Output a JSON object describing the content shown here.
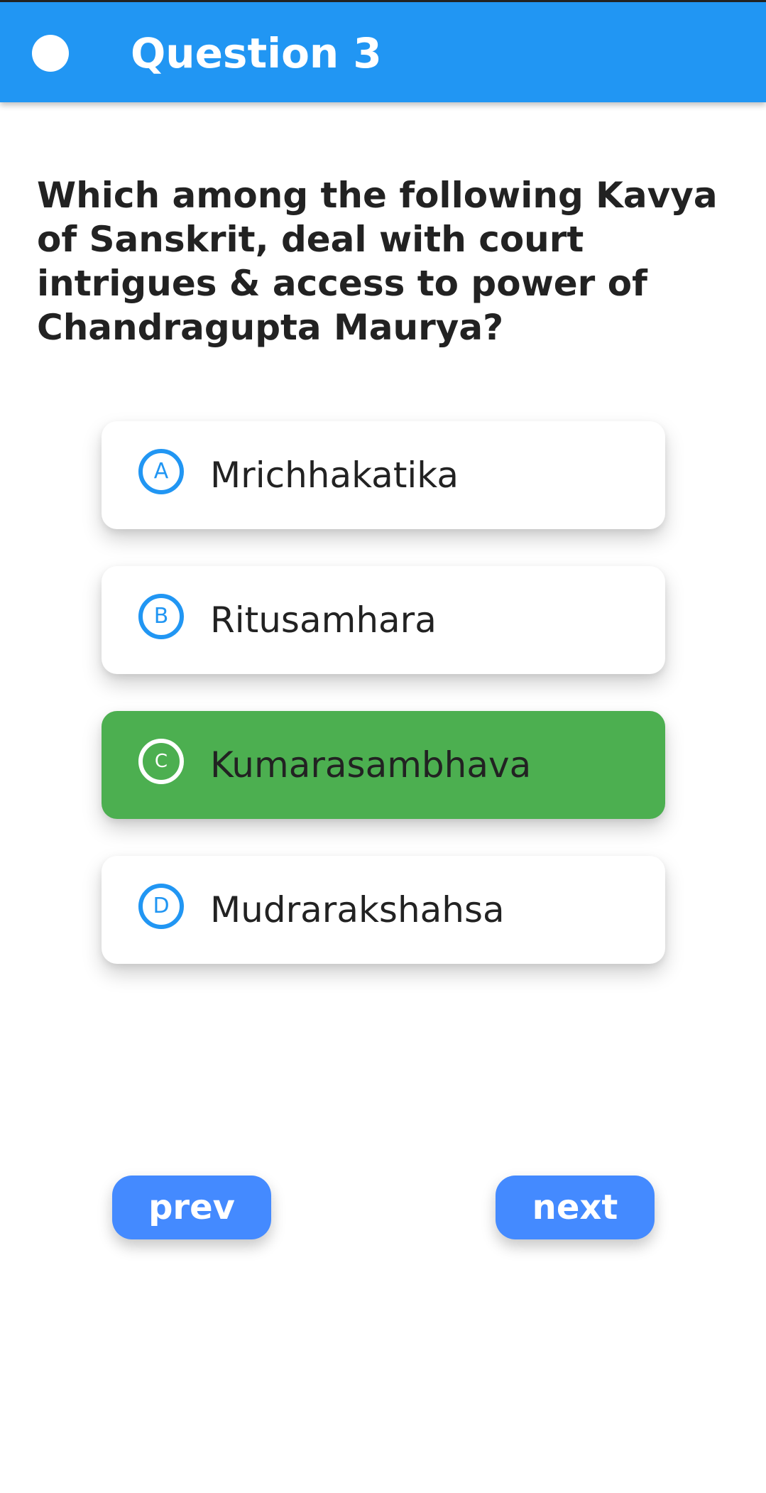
{
  "appbar": {
    "title": "Question 3"
  },
  "question": {
    "text": "Which among the following Kavya of Sanskrit, deal with court intrigues & access to power of Chandragupta Maurya?"
  },
  "options": [
    {
      "letter": "A",
      "label": "Mrichhakatika",
      "selected": false
    },
    {
      "letter": "B",
      "label": "Ritusamhara",
      "selected": false
    },
    {
      "letter": "C",
      "label": "Kumarasambhava",
      "selected": true
    },
    {
      "letter": "D",
      "label": "Mudrarakshahsa",
      "selected": false
    }
  ],
  "nav": {
    "prev_label": "prev",
    "next_label": "next"
  },
  "colors": {
    "appbar": "#2196F3",
    "selected": "#4CAF50",
    "button": "#448AFF",
    "badge_border": "#2196F3"
  }
}
